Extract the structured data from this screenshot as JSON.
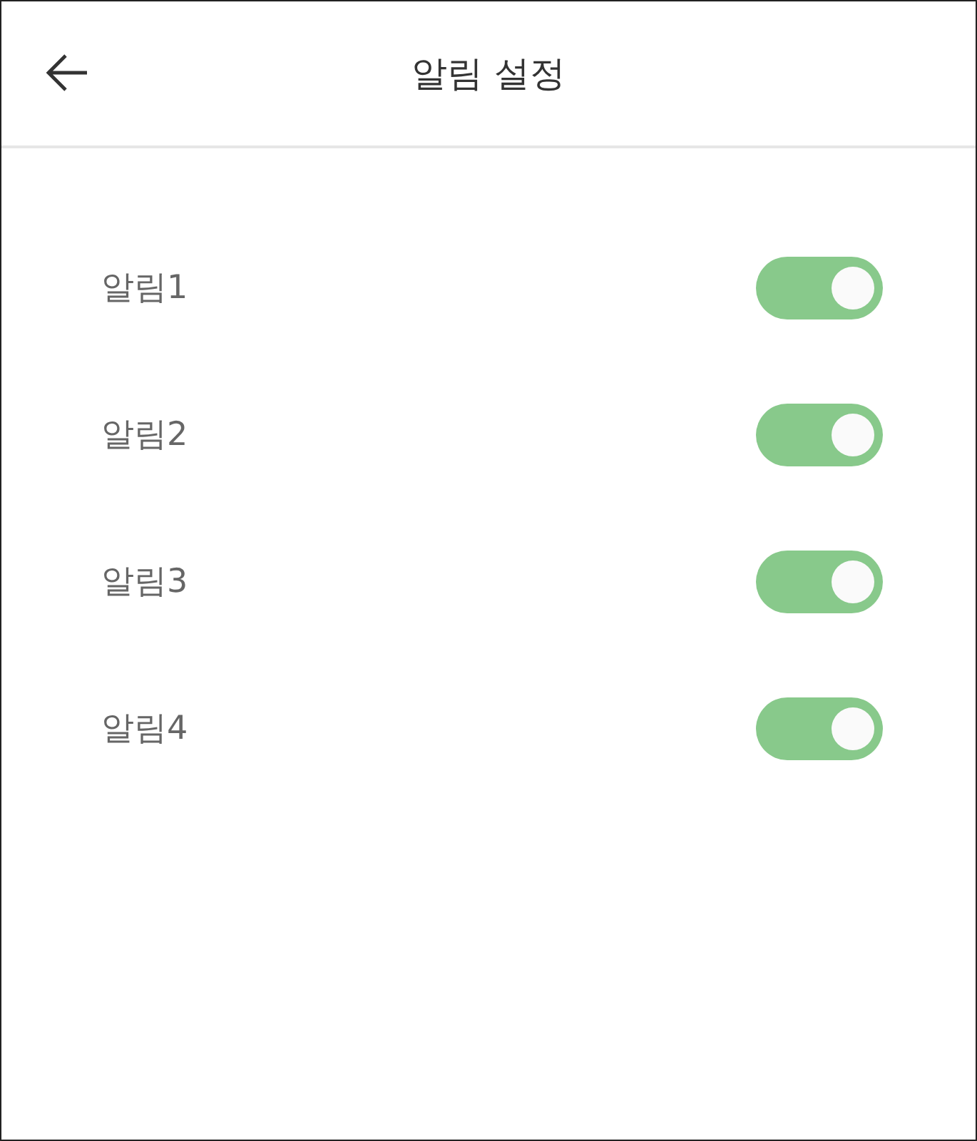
{
  "header": {
    "title": "알림 설정"
  },
  "settings": [
    {
      "label": "알림1",
      "on": true
    },
    {
      "label": "알림2",
      "on": true
    },
    {
      "label": "알림3",
      "on": true
    },
    {
      "label": "알림4",
      "on": true
    }
  ]
}
